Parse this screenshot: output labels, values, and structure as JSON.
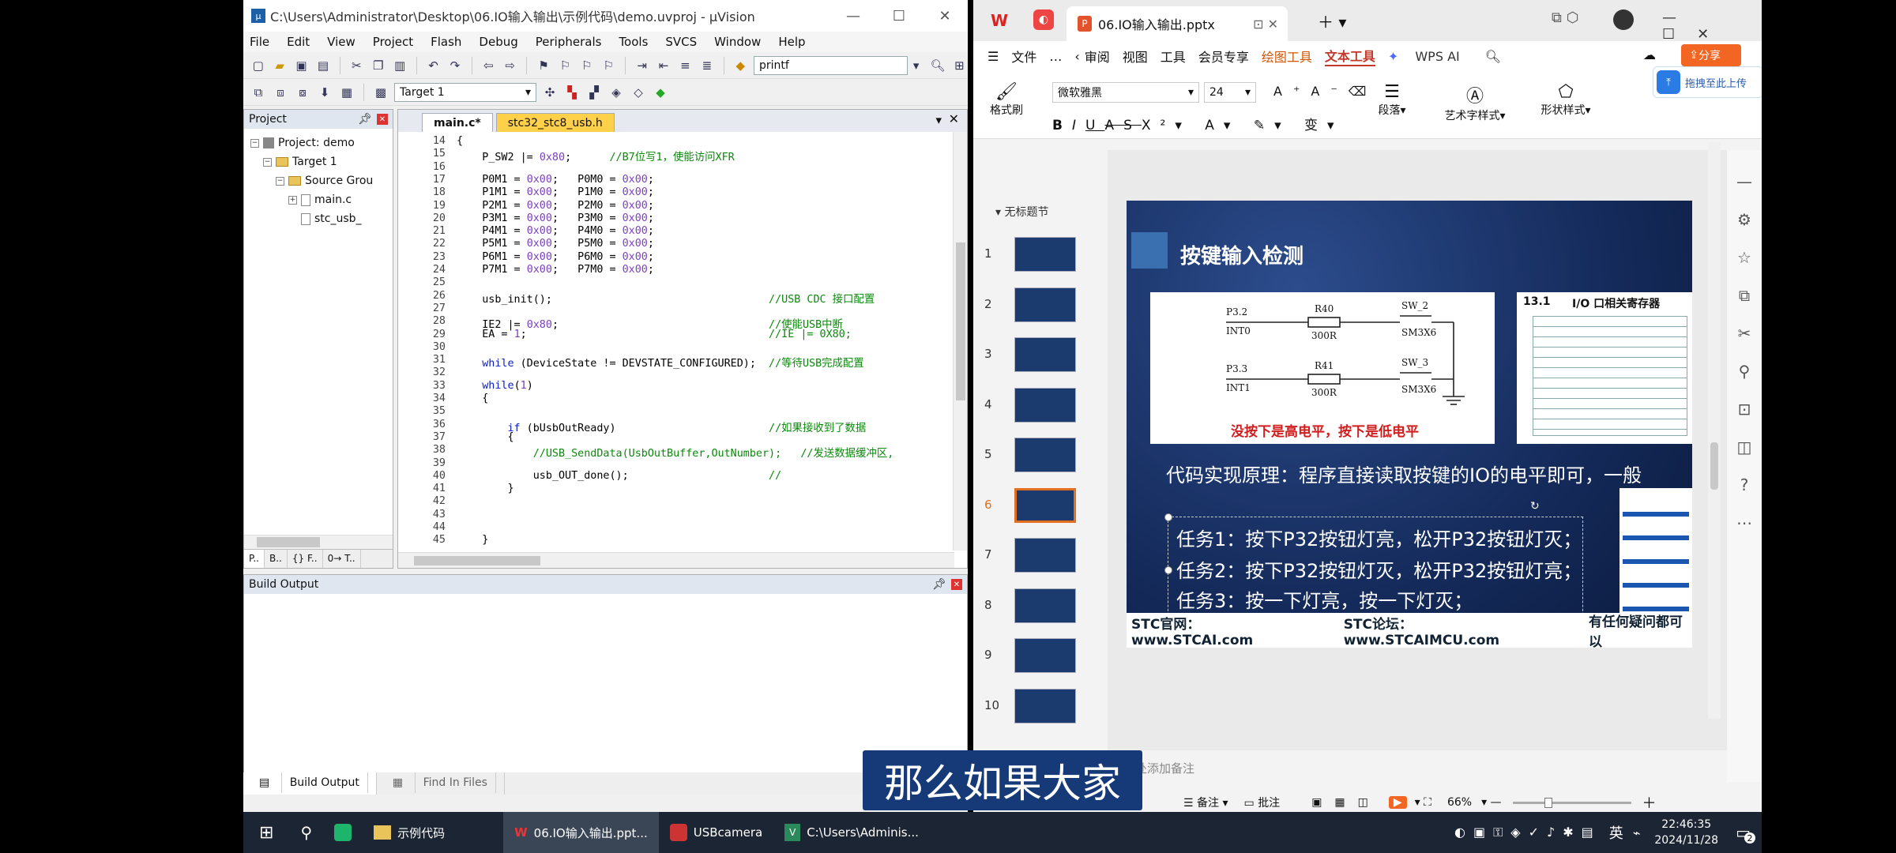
{
  "uvision": {
    "title": "C:\\Users\\Administrator\\Desktop\\06.IO输入输出\\示例代码\\demo.uvproj - µVision",
    "menu": [
      "File",
      "Edit",
      "View",
      "Project",
      "Flash",
      "Debug",
      "Peripherals",
      "Tools",
      "SVCS",
      "Window",
      "Help"
    ],
    "toolbar_search": "printf",
    "target": "Target 1",
    "project": {
      "header": "Project",
      "items": [
        "Project: demo",
        "Target 1",
        "Source Grou",
        "main.c",
        "stc_usb_"
      ],
      "tabs": [
        "P..",
        "B..",
        "{} F..",
        "0→ T.."
      ]
    },
    "editor": {
      "tabs": [
        "main.c*",
        "stc32_stc8_usb.h"
      ],
      "line_numbers": [
        "14",
        "15",
        "16",
        "17",
        "18",
        "19",
        "20",
        "21",
        "22",
        "23",
        "24",
        "25",
        "26",
        "27",
        "28",
        "29",
        "30",
        "31",
        "32",
        "33",
        "34",
        "35",
        "36",
        "37",
        "38",
        "39",
        "40",
        "41",
        "42",
        "43",
        "44",
        "45"
      ],
      "lines": [
        "{",
        "    P_SW2 |= 0x80;      //B7位写1，使能访问XFR",
        "",
        "    P0M1 = 0x00;   P0M0 = 0x00;",
        "    P1M1 = 0x00;   P1M0 = 0x00;",
        "    P2M1 = 0x00;   P2M0 = 0x00;",
        "    P3M1 = 0x00;   P3M0 = 0x00;",
        "    P4M1 = 0x00;   P4M0 = 0x00;",
        "    P5M1 = 0x00;   P5M0 = 0x00;",
        "    P6M1 = 0x00;   P6M0 = 0x00;",
        "    P7M1 = 0x00;   P7M0 = 0x00;",
        "",
        "    usb_init();                                  //USB CDC 接口配置",
        "",
        "    IE2 |= 0x80;                                 //使能USB中断",
        "    EA = 1;                                      //IE |= 0X80;",
        "",
        "    while (DeviceState != DEVSTATE_CONFIGURED);  //等待USB完成配置",
        "",
        "    while(1)",
        "    {",
        "",
        "        if (bUsbOutReady)                        //如果接收到了数据",
        "        {",
        "            //USB_SendData(UsbOutBuffer,OutNumber);   //发送数据缓冲区,",
        "",
        "            usb_OUT_done();                      //",
        "        }",
        "",
        "",
        "",
        "    }"
      ]
    },
    "build": {
      "header": "Build Output",
      "tabs": [
        "Build Output",
        "Find In Files"
      ]
    }
  },
  "wps": {
    "tab_title": "06.IO输入输出.pptx",
    "menubar": [
      "文件",
      "…",
      "审阅",
      "视图",
      "工具",
      "会员专享",
      "绘图工具",
      "文本工具",
      "WPS AI"
    ],
    "share": "分享",
    "drag_hint": "拖拽至此上传",
    "ribbon": {
      "format_brush": "格式刷",
      "font": "微软雅黑",
      "size": "24",
      "paragraph": "段落",
      "art": "艺术字样式",
      "shape": "形状样式"
    },
    "section": "无标题节",
    "thumbs": [
      "1",
      "2",
      "3",
      "4",
      "5",
      "6",
      "7",
      "8",
      "9",
      "10"
    ],
    "selected_thumb": 5,
    "slide": {
      "title": "按键输入检测",
      "circuit": {
        "p32": "P3.2",
        "int0": "INT0",
        "r40": "R40",
        "r40v": "300R",
        "sw2": "SW_2",
        "sw2t": "SM3X6",
        "p33": "P3.3",
        "int1": "INT1",
        "r41": "R41",
        "r41v": "300R",
        "sw3": "SW_3",
        "sw3t": "SM3X6",
        "caption": "没按下是高电平，按下是低电平"
      },
      "table_title": "13.1",
      "table_sub": "I/O 口相关寄存器",
      "principle": "代码实现原理：程序直接读取按键的IO的电平即可，一般",
      "tasks": [
        "任务1：按下P32按钮灯亮，松开P32按钮灯灭；",
        "任务2：按下P32按钮灯灭，松开P32按钮灯亮；",
        "任务3：按一下灯亮，按一下灯灭；"
      ],
      "footer": [
        "STC官网：www.STCAI.com",
        "STC论坛：www.STCAIMCU.com",
        "有任何疑问都可以"
      ]
    },
    "notes": "此处添加备注",
    "status": {
      "notes": "备注",
      "comment": "批注",
      "zoom": "66%"
    }
  },
  "subtitle": "那么如果大家",
  "taskbar": {
    "items": [
      "示例代码",
      "06.IO输入输出.ppt...",
      "USBcamera",
      "C:\\Users\\Adminis..."
    ],
    "lang": "英",
    "time": "22:46:35",
    "date": "2024/11/28",
    "notify": "2"
  }
}
